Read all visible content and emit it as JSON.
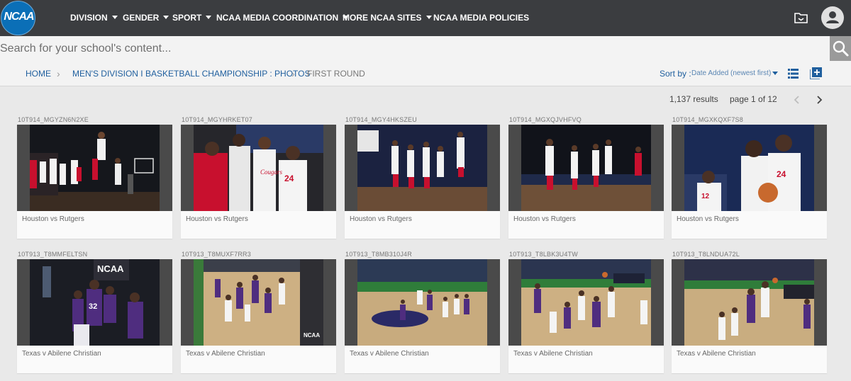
{
  "brand": {
    "logo_text": "NCAA"
  },
  "nav": {
    "items": [
      {
        "label": "DIVISION",
        "dropdown": true
      },
      {
        "label": "GENDER",
        "dropdown": true
      },
      {
        "label": "SPORT",
        "dropdown": true
      },
      {
        "label": "NCAA MEDIA COORDINATION",
        "dropdown": true
      },
      {
        "label": "MORE NCAA SITES",
        "dropdown": true
      },
      {
        "label": "NCAA MEDIA POLICIES",
        "dropdown": false
      }
    ],
    "icons": [
      "folder-icon",
      "user-avatar-icon"
    ]
  },
  "search": {
    "placeholder": "Search for your school's content...",
    "value": "",
    "icon": "search-icon"
  },
  "breadcrumb": {
    "items": [
      "HOME",
      "MEN'S DIVISION I BASKETBALL CHAMPIONSHIP : PHOTOS",
      "FIRST ROUND"
    ]
  },
  "sort": {
    "label": "Sort by :",
    "value": "Date Added (newest first)"
  },
  "results": {
    "count_text": "1,137 results",
    "page_text": "page 1 of 12"
  },
  "colors": {
    "nav_bg": "#3b3d40",
    "link": "#1f5f9e",
    "logo": "#0b6fb7",
    "houston_red": "#c8102e",
    "abilene_purple": "#4f2d7f",
    "texas_white": "#f4f4f4"
  },
  "cards": [
    {
      "id": "10T914_MGYZN6N2XE",
      "caption": "Houston vs Rutgers"
    },
    {
      "id": "10T914_MGYHRKET07",
      "caption": "Houston vs Rutgers"
    },
    {
      "id": "10T914_MGY4HKSZEU",
      "caption": "Houston vs Rutgers"
    },
    {
      "id": "10T914_MGXQJVHFVQ",
      "caption": "Houston vs Rutgers"
    },
    {
      "id": "10T914_MGXKQXF7S8",
      "caption": "Houston vs Rutgers"
    },
    {
      "id": "10T913_T8MMFELTSN",
      "caption": "Texas v Abilene Christian"
    },
    {
      "id": "10T913_T8MUXF7RR3",
      "caption": "Texas v Abilene Christian"
    },
    {
      "id": "10T913_T8MB310J4R",
      "caption": "Texas v Abilene Christian"
    },
    {
      "id": "10T913_T8LBK3U4TW",
      "caption": "Texas v Abilene Christian"
    },
    {
      "id": "10T913_T8LNDUA72L",
      "caption": "Texas v Abilene Christian"
    }
  ]
}
